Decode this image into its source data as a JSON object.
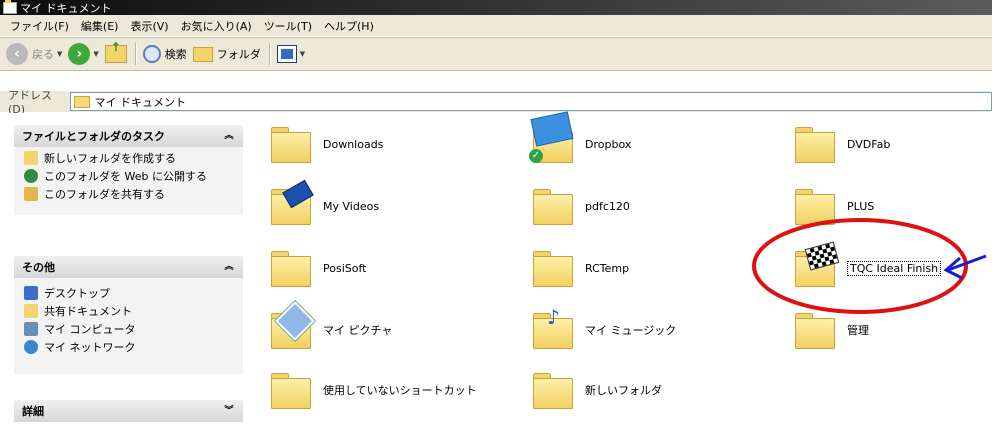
{
  "window": {
    "title": "マイ ドキュメント"
  },
  "menu": [
    "ファイル(F)",
    "編集(E)",
    "表示(V)",
    "お気に入り(A)",
    "ツール(T)",
    "ヘルプ(H)"
  ],
  "toolbar": {
    "back": "戻る",
    "search": "検索",
    "folders": "フォルダ"
  },
  "address": {
    "label": "アドレス(D)",
    "value": "マイ ドキュメント"
  },
  "sidebar": {
    "tasks": {
      "title": "ファイルとフォルダのタスク",
      "items": [
        "新しいフォルダを作成する",
        "このフォルダを Web に公開する",
        "このフォルダを共有する"
      ]
    },
    "other": {
      "title": "その他",
      "items": [
        "デスクトップ",
        "共有ドキュメント",
        "マイ コンピュータ",
        "マイ ネットワーク"
      ]
    },
    "details": {
      "title": "詳細"
    }
  },
  "items": [
    {
      "label": "Downloads",
      "icon": "folder-icon"
    },
    {
      "label": "Dropbox",
      "icon": "dropbox-icon"
    },
    {
      "label": "DVDFab",
      "icon": "folder-icon"
    },
    {
      "label": "My Videos",
      "icon": "video-folder-icon"
    },
    {
      "label": "pdfc120",
      "icon": "folder-icon"
    },
    {
      "label": "PLUS",
      "icon": "folder-icon"
    },
    {
      "label": "PosiSoft",
      "icon": "folder-icon"
    },
    {
      "label": "RCTemp",
      "icon": "folder-icon"
    },
    {
      "label": "TQC Ideal Finish",
      "icon": "checkered-flag-folder-icon"
    },
    {
      "label": "マイ ピクチャ",
      "icon": "picture-folder-icon"
    },
    {
      "label": "マイ ミュージック",
      "icon": "music-folder-icon"
    },
    {
      "label": "管理",
      "icon": "folder-icon"
    },
    {
      "label": "使用していないショートカット",
      "icon": "folder-icon"
    },
    {
      "label": "新しいフォルダ",
      "icon": "folder-icon"
    }
  ],
  "colors": {
    "annotation_circle": "#e01010",
    "annotation_arrow": "#1a1ad6",
    "chrome": "#ece9d8"
  }
}
